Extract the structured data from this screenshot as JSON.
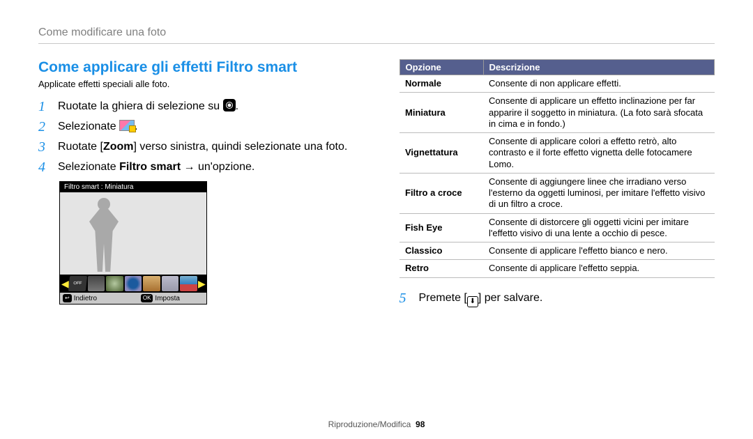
{
  "header": {
    "breadcrumb": "Come modificare una foto"
  },
  "section": {
    "heading": "Come applicare gli effetti Filtro smart",
    "intro": "Applicate effetti speciali alle foto."
  },
  "steps": {
    "s1": {
      "num": "1",
      "text_a": "Ruotate la ghiera di selezione su ",
      "text_b": "."
    },
    "s2": {
      "num": "2",
      "text_a": "Selezionate ",
      "text_b": "."
    },
    "s3": {
      "num": "3",
      "text_a": "Ruotate [",
      "bold": "Zoom",
      "text_b": "] verso sinistra, quindi selezionate una foto."
    },
    "s4": {
      "num": "4",
      "text_a": "Selezionate ",
      "bold": "Filtro smart",
      "text_b": " → un'opzione."
    },
    "s5": {
      "num": "5",
      "text_a": "Premete [",
      "icon_glyph": "⬇",
      "text_b": "] per salvare."
    }
  },
  "preview": {
    "titlebar": "Filtro smart : Miniatura",
    "off_label": "OFF",
    "back_key": "↩",
    "back_label": "Indietro",
    "ok_key": "OK",
    "ok_label": "Imposta"
  },
  "table": {
    "head_option": "Opzione",
    "head_desc": "Descrizione",
    "rows": [
      {
        "option": "Normale",
        "desc": "Consente di non applicare effetti."
      },
      {
        "option": "Miniatura",
        "desc": "Consente di applicare un effetto inclinazione per far apparire il soggetto in miniatura. (La foto sarà sfocata in cima e in fondo.)"
      },
      {
        "option": "Vignettatura",
        "desc": "Consente di applicare colori a effetto retrò, alto contrasto e il forte effetto vignetta delle fotocamere Lomo."
      },
      {
        "option": "Filtro a croce",
        "desc": "Consente di aggiungere linee che irradiano verso l'esterno da oggetti luminosi, per imitare l'effetto visivo di un filtro a croce."
      },
      {
        "option": "Fish Eye",
        "desc": "Consente di distorcere gli oggetti vicini per imitare l'effetto visivo di una lente a occhio di pesce."
      },
      {
        "option": "Classico",
        "desc": "Consente di applicare l'effetto bianco e nero."
      },
      {
        "option": "Retro",
        "desc": "Consente di applicare l'effetto seppia."
      }
    ]
  },
  "footer": {
    "section": "Riproduzione/Modifica",
    "page": "98"
  }
}
